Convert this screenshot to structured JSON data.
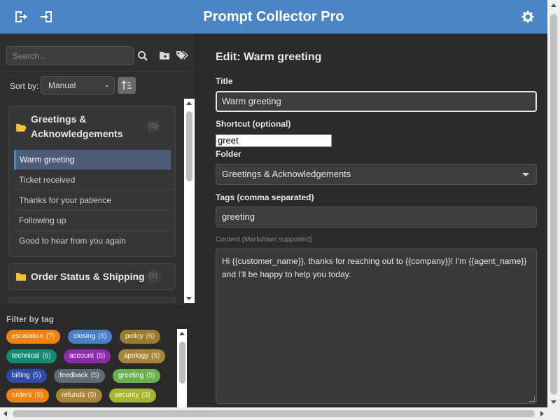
{
  "app": {
    "title": "Prompt Collector Pro"
  },
  "header": {
    "export_icon": "export-icon",
    "import_icon": "import-icon",
    "settings_icon": "gear-icon"
  },
  "sidebar": {
    "search_placeholder": "Search...",
    "sort_label": "Sort by:",
    "sort_value": "Manual",
    "folders": [
      {
        "name": "Greetings & Acknowledgements",
        "count": "(5)",
        "open": true,
        "items": [
          "Warm greeting",
          "Ticket received",
          "Thanks for your patience",
          "Following up",
          "Good to hear from you again"
        ]
      },
      {
        "name": "Order Status & Shipping",
        "count": "(5)",
        "open": false,
        "items": []
      }
    ],
    "active_item": "Warm greeting",
    "filter_title": "Filter by tag",
    "tags": [
      {
        "name": "escalation",
        "count": "(7)",
        "color": "#f0820f"
      },
      {
        "name": "closing",
        "count": "(6)",
        "color": "#4a7fc6"
      },
      {
        "name": "policy",
        "count": "(6)",
        "color": "#9a7b2d"
      },
      {
        "name": "technical",
        "count": "(6)",
        "color": "#138a72"
      },
      {
        "name": "account",
        "count": "(5)",
        "color": "#8d2bb0"
      },
      {
        "name": "apology",
        "count": "(5)",
        "color": "#a8853a"
      },
      {
        "name": "billing",
        "count": "(5)",
        "color": "#2f4aa8"
      },
      {
        "name": "feedback",
        "count": "(5)",
        "color": "#5f6b74"
      },
      {
        "name": "greeting",
        "count": "(5)",
        "color": "#6bb04e"
      },
      {
        "name": "orders",
        "count": "(5)",
        "color": "#f0820f"
      },
      {
        "name": "refunds",
        "count": "(5)",
        "color": "#a8853a"
      },
      {
        "name": "security",
        "count": "(3)",
        "color": "#a7b52d"
      }
    ]
  },
  "editor": {
    "heading": "Edit: Warm greeting",
    "title_label": "Title",
    "title_value": "Warm greeting",
    "shortcut_label": "Shortcut (optional)",
    "shortcut_value": "greet",
    "folder_label": "Folder",
    "folder_value": "Greetings & Acknowledgements",
    "tags_label": "Tags (comma separated)",
    "tags_value": "greeting",
    "content_label": "Content (Markdown supported)",
    "content_value": "Hi {{customer_name}}, thanks for reaching out to {{company}}! I'm {{agent_name}} and I'll be happy to help you today."
  }
}
